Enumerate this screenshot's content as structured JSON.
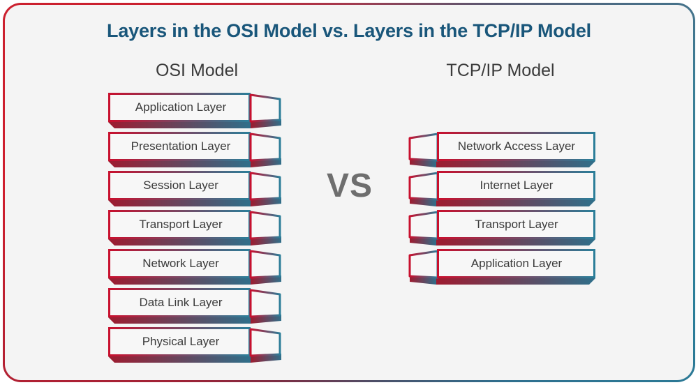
{
  "title": "Layers in the OSI Model vs. Layers in the TCP/IP Model",
  "comparator": "VS",
  "columns": {
    "osi": {
      "heading": "OSI Model",
      "layers": [
        "Application Layer",
        "Presentation Layer",
        "Session Layer",
        "Transport Layer",
        "Network Layer",
        "Data Link Layer",
        "Physical Layer"
      ]
    },
    "tcpip": {
      "heading": "TCP/IP Model",
      "layers": [
        "Network Access Layer",
        "Internet Layer",
        "Transport Layer",
        "Application Layer"
      ]
    }
  },
  "colors": {
    "title_text": "#19567a",
    "heading_text": "#3b3b3b",
    "label_text": "#3a3a3a",
    "vs_text": "#6e6e6e",
    "background": "#f4f4f4",
    "box_fill": "#f7f7f7",
    "gradient_red": "#c8102e",
    "gradient_teal": "#2b7e99",
    "shadow_red": "#9e1b2f",
    "shadow_teal": "#2f6f8a",
    "frame_red": "#9e2236",
    "frame_teal": "#2b7e99"
  }
}
